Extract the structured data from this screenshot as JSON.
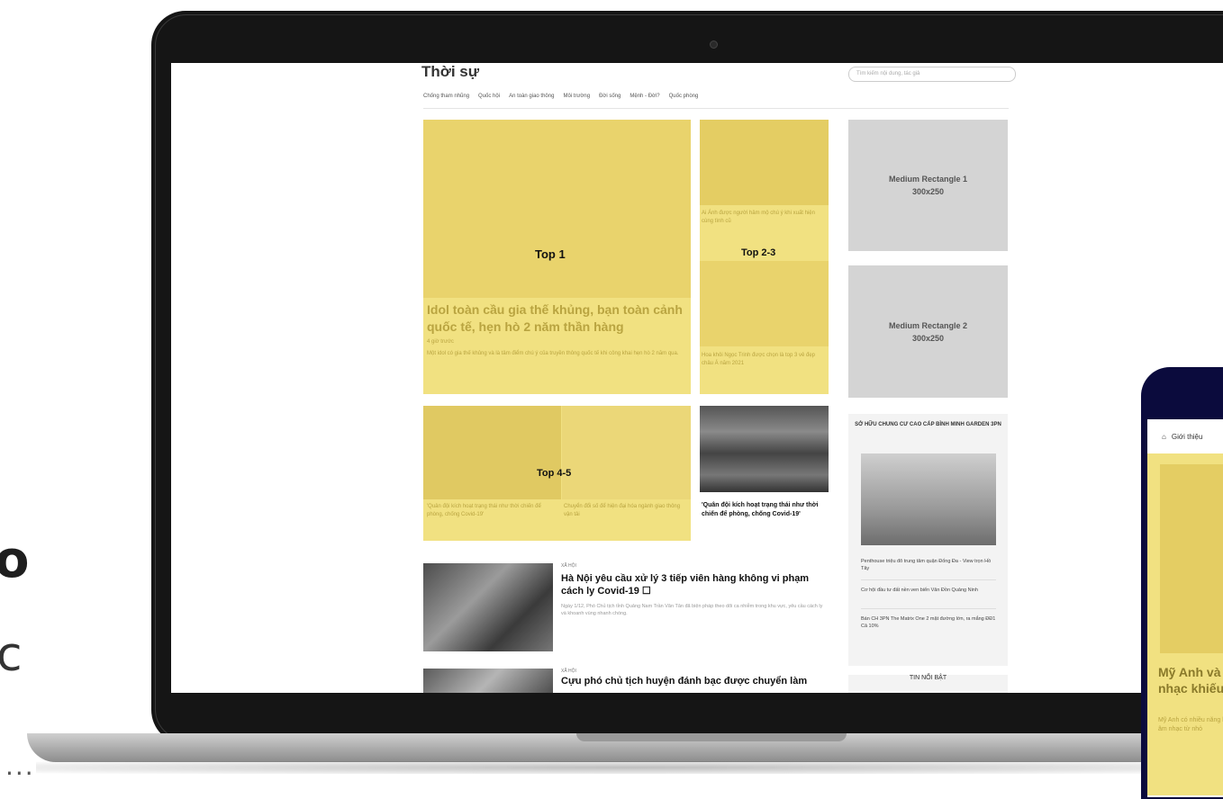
{
  "side_text": {
    "char1": "o",
    "char2": "c",
    "ellipsis": "..."
  },
  "site": {
    "section_title": "Thời sự",
    "search_placeholder": "Tìm kiếm nội dung, tác giả",
    "subnav": [
      "Chống tham nhũng",
      "Quốc hội",
      "An toàn giao thông",
      "Môi trường",
      "Đời sống",
      "Mệnh - Đời?",
      "Quốc phòng"
    ]
  },
  "top1": {
    "label": "Top 1",
    "headline": "Idol toàn cầu gia thế khủng, bạn toàn cảnh quốc tế, hẹn hò 2 năm thần hàng",
    "meta": "4 giờ trước",
    "sapo": "Một idol có gia thế khủng và là tâm điểm chú ý của truyền thông quốc tế khi công khai hẹn hò 2 năm qua."
  },
  "top23": {
    "label": "Top 2-3",
    "text1": "Ai Ánh được người hâm mộ chú ý khi xuất hiện cùng tình cũ",
    "text2": "Hoa khôi Ngọc Trinh được chọn là top 3 vẻ đẹp châu Á năm 2021"
  },
  "ads": {
    "ad1_name": "Medium Rectangle 1",
    "ad1_size": "300x250",
    "ad2_name": "Medium Rectangle 2",
    "ad2_size": "300x250"
  },
  "top45": {
    "label": "Top 4-5",
    "cap1": "'Quân đội kích hoạt trạng thái như thời chiến để phòng, chống Covid-19'",
    "cap2": "Chuyển đổi số để hiện đại hóa ngành giao thông vận tải"
  },
  "card6": {
    "title": "'Quân đội kích hoạt trạng thái như thời chiến để phòng, chống Covid-19'"
  },
  "promo": {
    "title": "SỞ HỮU CHUNG CƯ CAO CẤP BÌNH MINH GARDEN 3PN",
    "items": [
      "Penthouse triệu đô trung tâm quận Đống Đa - View trọn Hồ Tây",
      "Cơ hội đầu tư đất nền ven biển Vân Đồn Quảng Ninh",
      "Bán CH 3PN The Matrix One 2 mặt đường lớn, ra mắng ĐĐ1 Cả 10%"
    ],
    "hot_label": "TIN NỔI BẬT"
  },
  "news": [
    {
      "category": "XÃ HỘI",
      "headline": "Hà Nội yêu cầu xử lý 3 tiếp viên hàng không vi phạm cách ly Covid-19 ☐",
      "sapo": "Ngày 1/12, Phó Chủ tịch tỉnh Quảng Nam Trần Văn Tân đã biện pháp theo dõi ca nhiễm trong khu vực, yêu cầu cách ly và khoanh vùng nhanh chóng."
    },
    {
      "category": "XÃ HỘI",
      "headline": "Cựu phó chủ tịch huyện đánh bạc được chuyển làm"
    }
  ],
  "phone": {
    "nav_text": "Giới thiệu",
    "headline": "Mỹ Anh và nhạc khiếu",
    "sapo": "Mỹ Anh có nhiều năng khiếu âm nhạc từ nhỏ"
  }
}
